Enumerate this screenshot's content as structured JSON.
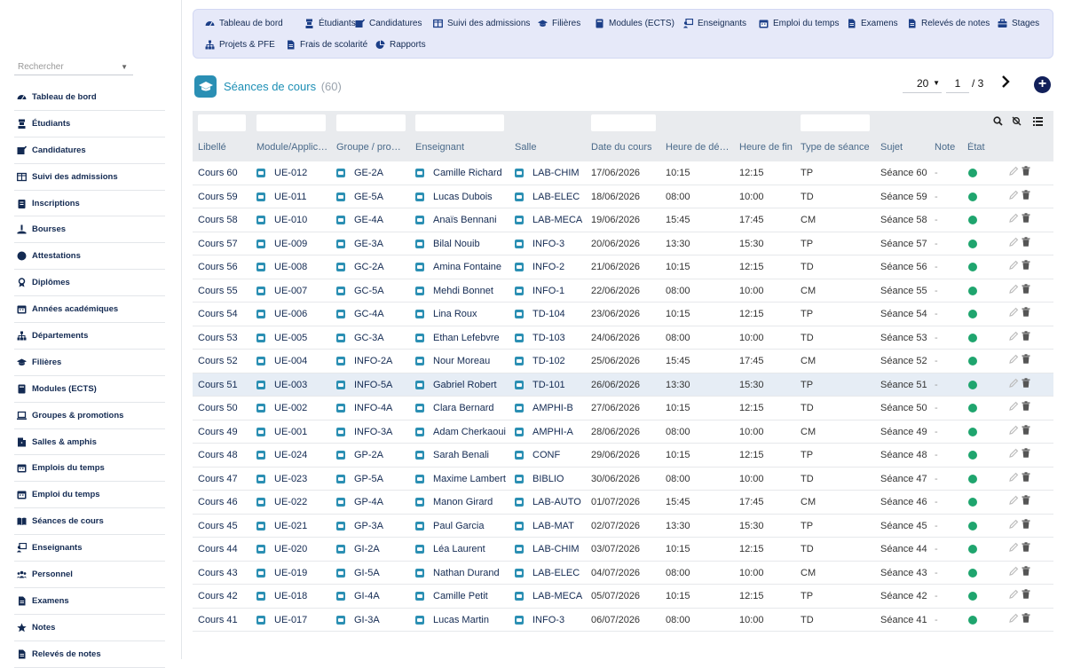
{
  "colors": {
    "accent": "#1d8fb5",
    "nav_bg": "#e6e9f9",
    "status_ok": "#1fa56e",
    "primary_dark": "#12205a"
  },
  "search": {
    "placeholder": "Rechercher"
  },
  "sidebar": {
    "items": [
      {
        "label": "Tableau de bord",
        "icon": "dashboard-icon"
      },
      {
        "label": "Étudiants",
        "icon": "student-icon"
      },
      {
        "label": "Candidatures",
        "icon": "application-icon"
      },
      {
        "label": "Suivi des admissions",
        "icon": "columns-icon"
      },
      {
        "label": "Inscriptions",
        "icon": "clipboard-icon"
      },
      {
        "label": "Bourses",
        "icon": "scholarship-icon"
      },
      {
        "label": "Attestations",
        "icon": "certificate-icon"
      },
      {
        "label": "Diplômes",
        "icon": "diploma-icon"
      },
      {
        "label": "Années académiques",
        "icon": "calendar-icon"
      },
      {
        "label": "Départements",
        "icon": "sitemap-icon"
      },
      {
        "label": "Filières",
        "icon": "graduation-cap-icon"
      },
      {
        "label": "Modules (ECTS)",
        "icon": "book-icon"
      },
      {
        "label": "Groupes & promotions",
        "icon": "laptop-icon"
      },
      {
        "label": "Salles & amphis",
        "icon": "room-icon"
      },
      {
        "label": "Emplois du temps",
        "icon": "calendar-icon"
      },
      {
        "label": "Emploi du temps",
        "icon": "calendar-icon"
      },
      {
        "label": "Séances de cours",
        "icon": "open-book-icon"
      },
      {
        "label": "Enseignants",
        "icon": "teacher-icon"
      },
      {
        "label": "Personnel",
        "icon": "users-icon"
      },
      {
        "label": "Examens",
        "icon": "file-icon"
      },
      {
        "label": "Notes",
        "icon": "star-icon"
      },
      {
        "label": "Relevés de notes",
        "icon": "file-icon"
      }
    ]
  },
  "topnav": {
    "items": [
      {
        "label": "Tableau de bord",
        "icon": "dashboard-icon"
      },
      {
        "label": "Étudiants",
        "icon": "student-icon"
      },
      {
        "label": "Candidatures",
        "icon": "application-icon"
      },
      {
        "label": "Suivi des admissions",
        "icon": "columns-icon"
      },
      {
        "label": "Filières",
        "icon": "graduation-cap-icon"
      },
      {
        "label": "Modules (ECTS)",
        "icon": "book-icon"
      },
      {
        "label": "Enseignants",
        "icon": "teacher-icon"
      },
      {
        "label": "Emploi du temps",
        "icon": "calendar-icon"
      },
      {
        "label": "Examens",
        "icon": "file-icon"
      },
      {
        "label": "Relevés de notes",
        "icon": "file-icon"
      },
      {
        "label": "Stages",
        "icon": "briefcase-icon"
      },
      {
        "label": "Projets & PFE",
        "icon": "sitemap-icon"
      },
      {
        "label": "Frais de scolarité",
        "icon": "file-icon"
      },
      {
        "label": "Rapports",
        "icon": "pie-chart-icon"
      }
    ]
  },
  "page": {
    "title": "Séances de cours",
    "count": "(60)"
  },
  "pager": {
    "page_size": "20",
    "page": "1",
    "total": "/ 3"
  },
  "table": {
    "headers": [
      "Libellé",
      "Module/Applic…",
      "Groupe / pro…",
      "Enseignant",
      "Salle",
      "Date du cours",
      "Heure de dé…",
      "Heure de fin",
      "Type de séance",
      "Sujet",
      "Note",
      "État"
    ],
    "rows": [
      [
        "Cours 60",
        "UE-012",
        "GE-2A",
        "Camille Richard",
        "LAB-CHIM",
        "17/06/2026",
        "10:15",
        "12:15",
        "TP",
        "Séance 60",
        "-"
      ],
      [
        "Cours 59",
        "UE-011",
        "GE-5A",
        "Lucas Dubois",
        "LAB-ELEC",
        "18/06/2026",
        "08:00",
        "10:00",
        "TD",
        "Séance 59",
        "-"
      ],
      [
        "Cours 58",
        "UE-010",
        "GE-4A",
        "Anaïs Bennani",
        "LAB-MECA",
        "19/06/2026",
        "15:45",
        "17:45",
        "CM",
        "Séance 58",
        "-"
      ],
      [
        "Cours 57",
        "UE-009",
        "GE-3A",
        "Bilal Nouib",
        "INFO-3",
        "20/06/2026",
        "13:30",
        "15:30",
        "TP",
        "Séance 57",
        "-"
      ],
      [
        "Cours 56",
        "UE-008",
        "GC-2A",
        "Amina Fontaine",
        "INFO-2",
        "21/06/2026",
        "10:15",
        "12:15",
        "TD",
        "Séance 56",
        "-"
      ],
      [
        "Cours 55",
        "UE-007",
        "GC-5A",
        "Mehdi Bonnet",
        "INFO-1",
        "22/06/2026",
        "08:00",
        "10:00",
        "CM",
        "Séance 55",
        "-"
      ],
      [
        "Cours 54",
        "UE-006",
        "GC-4A",
        "Lina Roux",
        "TD-104",
        "23/06/2026",
        "10:15",
        "12:15",
        "TP",
        "Séance 54",
        "-"
      ],
      [
        "Cours 53",
        "UE-005",
        "GC-3A",
        "Ethan Lefebvre",
        "TD-103",
        "24/06/2026",
        "08:00",
        "10:00",
        "TD",
        "Séance 53",
        "-"
      ],
      [
        "Cours 52",
        "UE-004",
        "INFO-2A",
        "Nour Moreau",
        "TD-102",
        "25/06/2026",
        "15:45",
        "17:45",
        "CM",
        "Séance 52",
        "-"
      ],
      [
        "Cours 51",
        "UE-003",
        "INFO-5A",
        "Gabriel Robert",
        "TD-101",
        "26/06/2026",
        "13:30",
        "15:30",
        "TP",
        "Séance 51",
        "-"
      ],
      [
        "Cours 50",
        "UE-002",
        "INFO-4A",
        "Clara Bernard",
        "AMPHI-B",
        "27/06/2026",
        "10:15",
        "12:15",
        "TD",
        "Séance 50",
        "-"
      ],
      [
        "Cours 49",
        "UE-001",
        "INFO-3A",
        "Adam Cherkaoui",
        "AMPHI-A",
        "28/06/2026",
        "08:00",
        "10:00",
        "CM",
        "Séance 49",
        "-"
      ],
      [
        "Cours 48",
        "UE-024",
        "GP-2A",
        "Sarah Benali",
        "CONF",
        "29/06/2026",
        "10:15",
        "12:15",
        "TP",
        "Séance 48",
        "-"
      ],
      [
        "Cours 47",
        "UE-023",
        "GP-5A",
        "Maxime Lambert",
        "BIBLIO",
        "30/06/2026",
        "08:00",
        "10:00",
        "TD",
        "Séance 47",
        "-"
      ],
      [
        "Cours 46",
        "UE-022",
        "GP-4A",
        "Manon Girard",
        "LAB-AUTO",
        "01/07/2026",
        "15:45",
        "17:45",
        "CM",
        "Séance 46",
        "-"
      ],
      [
        "Cours 45",
        "UE-021",
        "GP-3A",
        "Paul Garcia",
        "LAB-MAT",
        "02/07/2026",
        "13:30",
        "15:30",
        "TP",
        "Séance 45",
        "-"
      ],
      [
        "Cours 44",
        "UE-020",
        "GI-2A",
        "Léa Laurent",
        "LAB-CHIM",
        "03/07/2026",
        "10:15",
        "12:15",
        "TD",
        "Séance 44",
        "-"
      ],
      [
        "Cours 43",
        "UE-019",
        "GI-5A",
        "Nathan Durand",
        "LAB-ELEC",
        "04/07/2026",
        "08:00",
        "10:00",
        "CM",
        "Séance 43",
        "-"
      ],
      [
        "Cours 42",
        "UE-018",
        "GI-4A",
        "Camille Petit",
        "LAB-MECA",
        "05/07/2026",
        "10:15",
        "12:15",
        "TP",
        "Séance 42",
        "-"
      ],
      [
        "Cours 41",
        "UE-017",
        "GI-3A",
        "Lucas Martin",
        "INFO-3",
        "06/07/2026",
        "08:00",
        "10:00",
        "TD",
        "Séance 41",
        "-"
      ]
    ]
  }
}
